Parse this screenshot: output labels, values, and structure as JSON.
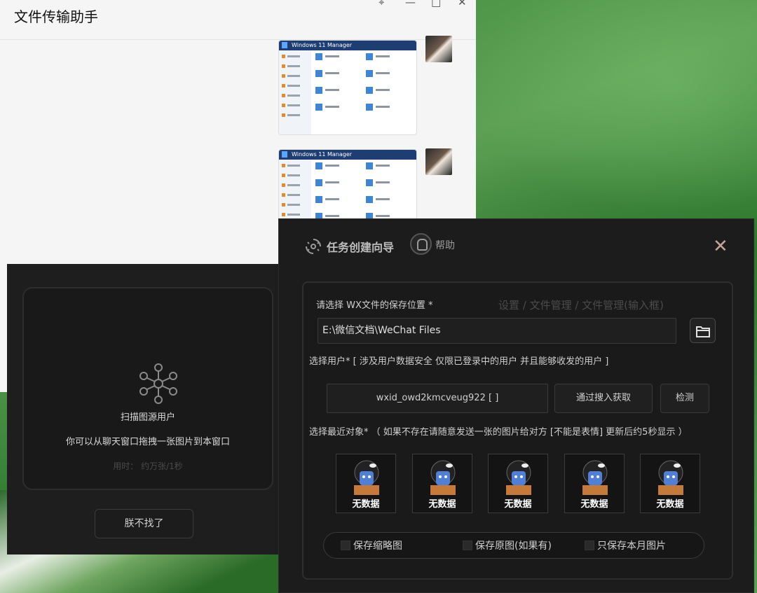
{
  "wechat": {
    "title": "文件传输助手",
    "controls": {
      "pin": "⌖",
      "minimize": "—",
      "maximize": "□",
      "close": "✕"
    },
    "thumb_title": "Windows 11 Manager"
  },
  "scan": {
    "title": "扫描图源用户",
    "description": "你可以从聊天窗口拖拽一张图片到本窗口",
    "time": "用时： 约万张/1秒",
    "cant_find_label": "朕不找了"
  },
  "wizard": {
    "title": "任务创建向导",
    "help_label": "帮助",
    "close_icon": "✕",
    "save_location_label": "请选择 WX文件的保存位置 *",
    "path_hint": "设置  /  文件管理  /  文件管理(输入框)",
    "path_value": "E:\\微信文档\\WeChat Files",
    "user_label": "选择用户*  [ 涉及用户数据安全  仅限已登录中的用户 并且能够收发的用户 ]",
    "wxid_value": "wxid_owd2kmcveug922  [ ]",
    "search_button": "通过搜入获取",
    "detect_button": "检测",
    "recent_label": "选择最近对象* （ 如果不存在请随意发送一张的图片给对方 [不能是表情] 更新后约5秒显示 ）",
    "recent_items": [
      {
        "label": "无数据"
      },
      {
        "label": "无数据"
      },
      {
        "label": "无数据"
      },
      {
        "label": "无数据"
      },
      {
        "label": "无数据"
      }
    ],
    "options": {
      "thumb": "保存缩略图",
      "original": "保存原图(如果有)",
      "month": "只保存本月图片"
    }
  },
  "colors": {
    "wizard_bg": "#1c1c1c",
    "accent_close": "#c5a29a",
    "desktop_green": "#4a8a44"
  }
}
